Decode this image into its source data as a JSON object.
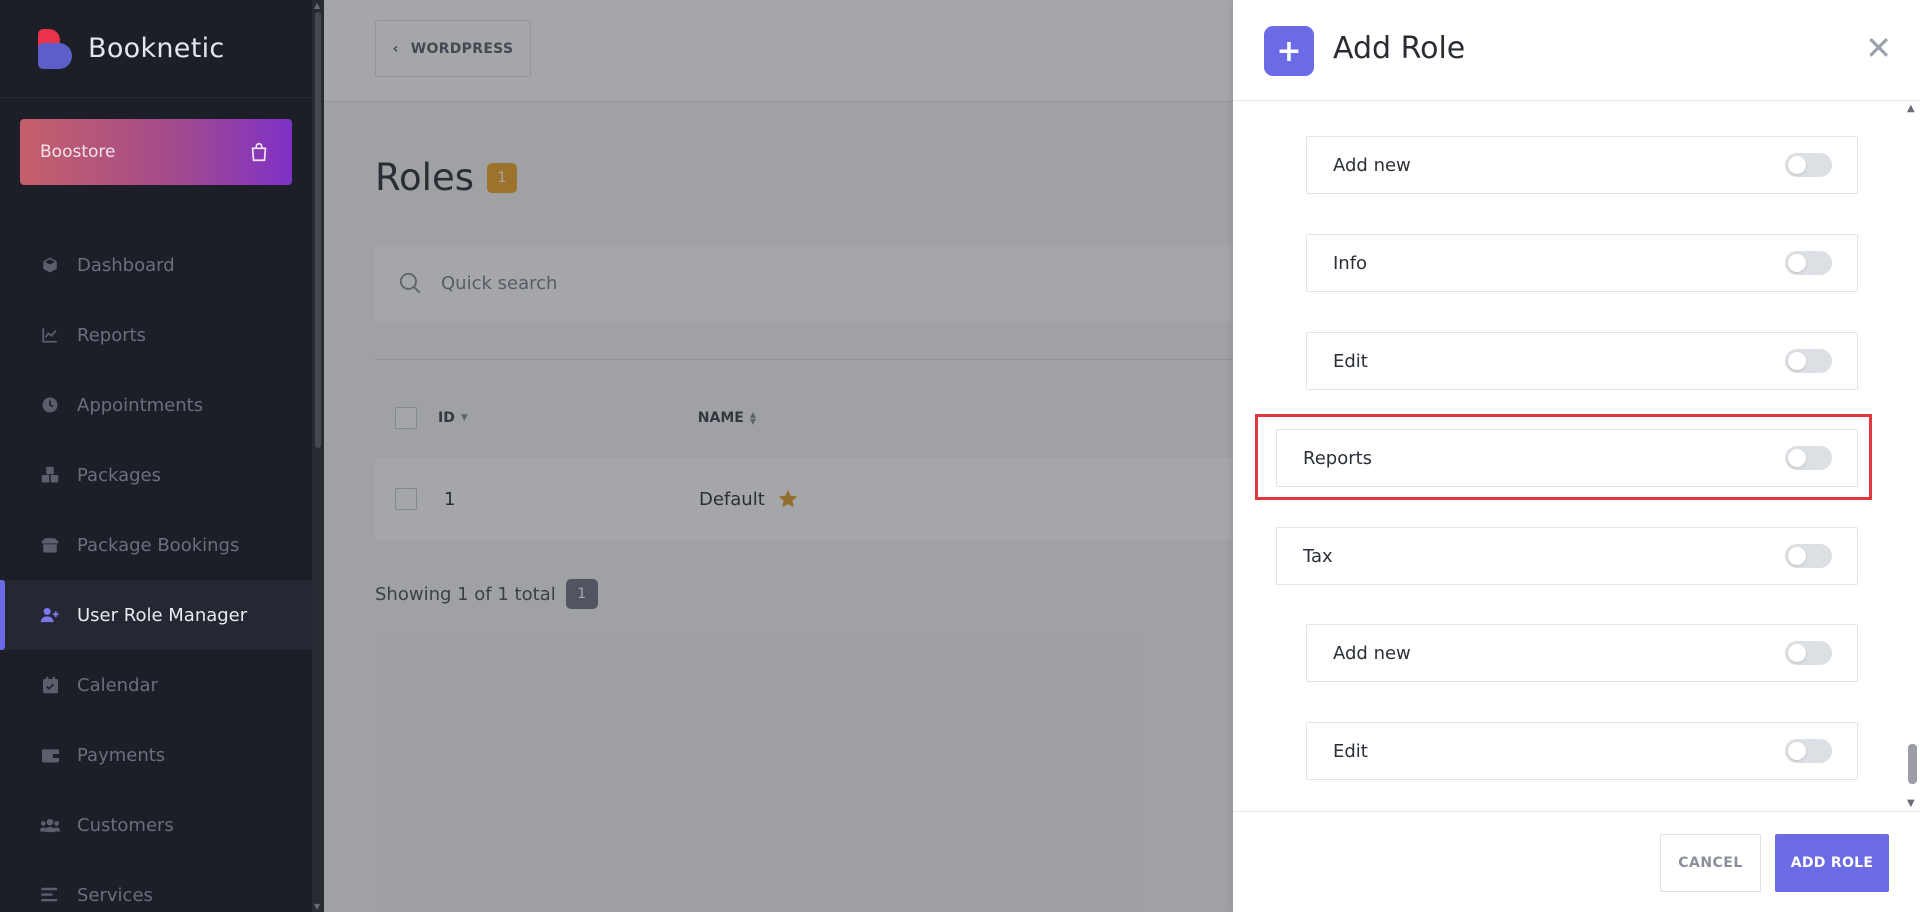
{
  "app": {
    "brand": "Booknetic"
  },
  "sidebar": {
    "boostore_label": "Boostore",
    "items": [
      {
        "label": "Dashboard",
        "icon": "cube-icon"
      },
      {
        "label": "Reports",
        "icon": "chart-icon"
      },
      {
        "label": "Appointments",
        "icon": "clock-icon"
      },
      {
        "label": "Packages",
        "icon": "boxes-icon"
      },
      {
        "label": "Package Bookings",
        "icon": "box-open-icon"
      },
      {
        "label": "User Role Manager",
        "icon": "user-plus-icon",
        "active": true
      },
      {
        "label": "Calendar",
        "icon": "calendar-check-icon"
      },
      {
        "label": "Payments",
        "icon": "wallet-icon"
      },
      {
        "label": "Customers",
        "icon": "users-icon"
      },
      {
        "label": "Services",
        "icon": "list-icon"
      }
    ]
  },
  "main": {
    "back_label": "WORDPRESS",
    "title": "Roles",
    "count": "1",
    "search_placeholder": "Quick search",
    "columns": {
      "id": "ID",
      "name": "NAME"
    },
    "rows": [
      {
        "id": "1",
        "name": "Default",
        "favorite": true
      }
    ],
    "showing_text": "Showing 1 of 1 total",
    "page": "1"
  },
  "panel": {
    "title": "Add Role",
    "permissions": [
      {
        "label": "Add new",
        "enabled": false
      },
      {
        "label": "Info",
        "enabled": false
      },
      {
        "label": "Edit",
        "enabled": false
      },
      {
        "label": "Reports",
        "enabled": false,
        "highlighted": true
      },
      {
        "label": "Tax",
        "enabled": false
      },
      {
        "label": "Add new",
        "enabled": false
      },
      {
        "label": "Edit",
        "enabled": false
      }
    ],
    "cancel_label": "CANCEL",
    "submit_label": "ADD ROLE"
  },
  "colors": {
    "accent": "#6c6be6",
    "sidebar_bg": "#1c1f28",
    "badge": "#f2a52a",
    "highlight": "#e0383f"
  }
}
